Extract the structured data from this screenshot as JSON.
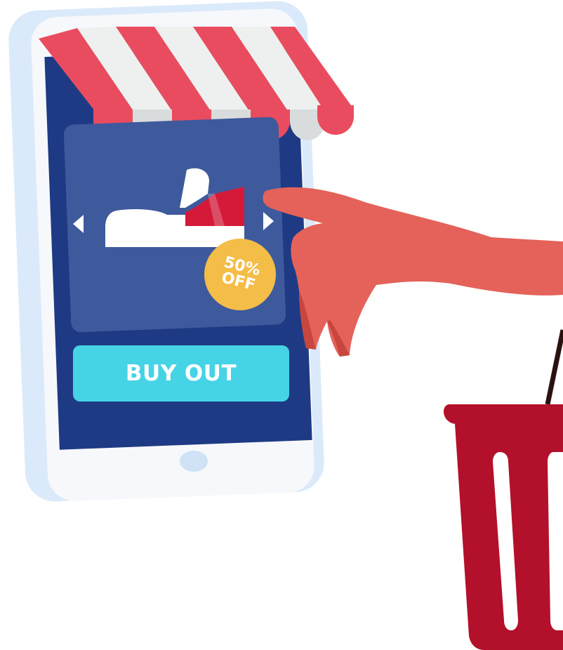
{
  "product_card": {
    "badge_text": "50%\nOFF",
    "buy_button_label": "BUY OUT"
  },
  "colors": {
    "screen": "#1f3a84",
    "card": "#3e5a9c",
    "button": "#45d3e6",
    "badge": "#f4bd48",
    "awning_red": "#ea4c5f",
    "hand": "#e4625a",
    "basket": "#b3102b"
  }
}
